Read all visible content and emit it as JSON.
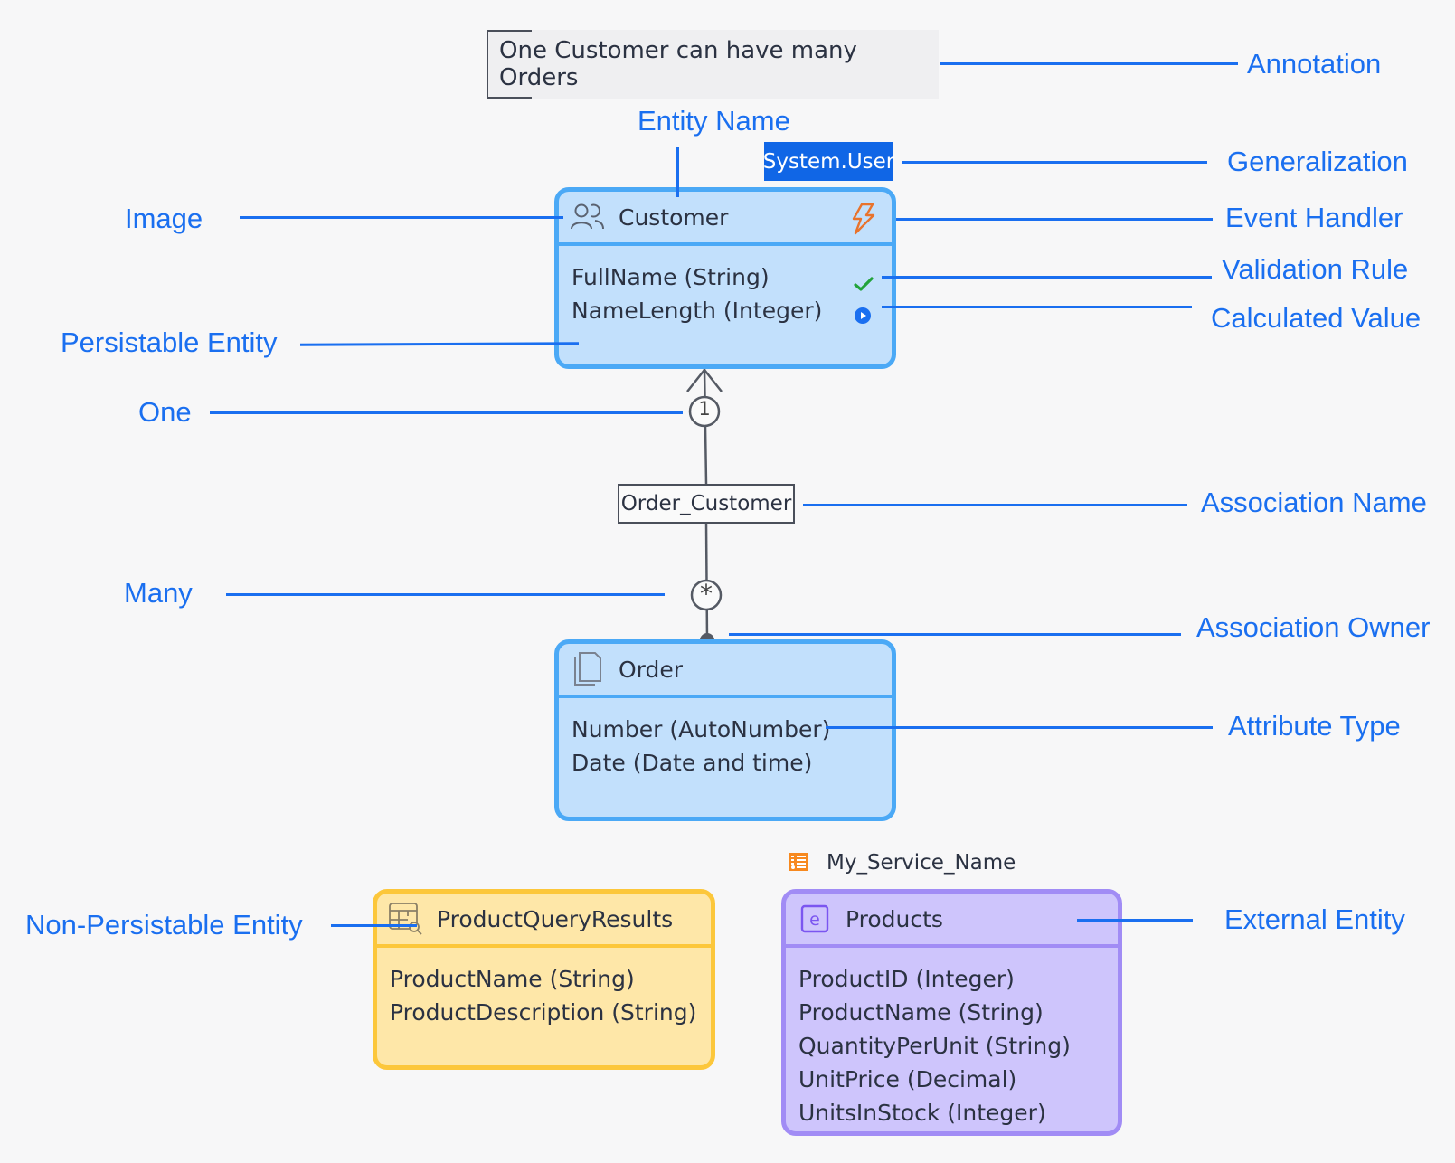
{
  "annotation": {
    "text": "One Customer can have many Orders"
  },
  "generalization": {
    "label": "System.User"
  },
  "association": {
    "name": "Order_Customer",
    "one_marker": "1",
    "many_marker": "*"
  },
  "entities": {
    "customer": {
      "name": "Customer",
      "icon": "users-icon",
      "event_icon": "lightning-icon",
      "color": "#c2e0fc",
      "attributes": [
        {
          "label": "FullName (String)",
          "marker": "validation-check-icon"
        },
        {
          "label": "NameLength (Integer)",
          "marker": "calculated-play-icon"
        }
      ]
    },
    "order": {
      "name": "Order",
      "icon": "documents-icon",
      "color": "#c2e0fc",
      "attributes": [
        {
          "label": "Number (AutoNumber)"
        },
        {
          "label": "Date (Date and time)"
        }
      ]
    },
    "product_query_results": {
      "name": "ProductQueryResults",
      "icon": "table-search-icon",
      "color": "#fee7a8",
      "attributes": [
        {
          "label": "ProductName (String)"
        },
        {
          "label": "ProductDescription (String)"
        }
      ]
    },
    "products": {
      "name": "Products",
      "icon": "external-e-icon",
      "service": "My_Service_Name",
      "service_icon": "odata-service-icon",
      "color": "#cec5fc",
      "attributes": [
        {
          "label": "ProductID (Integer)"
        },
        {
          "label": "ProductName (String)"
        },
        {
          "label": "QuantityPerUnit (String)"
        },
        {
          "label": "UnitPrice (Decimal)"
        },
        {
          "label": "UnitsInStock (Integer)"
        }
      ]
    }
  },
  "callouts": {
    "annotation": "Annotation",
    "entity_name": "Entity Name",
    "generalization": "Generalization",
    "image": "Image",
    "event_handler": "Event Handler",
    "validation_rule": "Validation Rule",
    "calculated_value": "Calculated Value",
    "persistable_entity": "Persistable Entity",
    "one": "One",
    "association_name": "Association Name",
    "many": "Many",
    "association_owner": "Association Owner",
    "attribute_type": "Attribute Type",
    "non_persistable_entity": "Non-Persistable Entity",
    "external_entity": "External Entity"
  },
  "colors": {
    "callout": "#1a6ff0",
    "generalization_badge": "#1066e6",
    "persistable_border": "#4ba9f6",
    "non_persistable_border": "#fcc73b",
    "external_border": "#a18cf5",
    "event_handler": "#e8732c",
    "validation": "#22a33a"
  }
}
